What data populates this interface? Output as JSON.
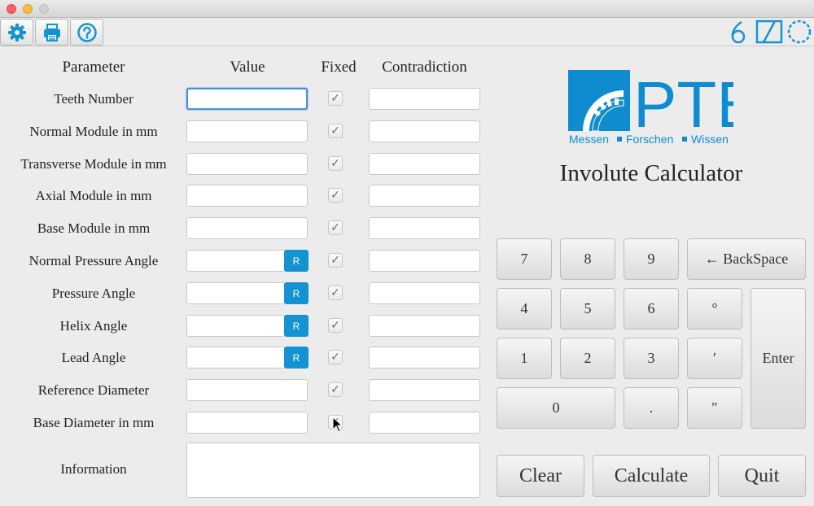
{
  "window": {
    "title": ""
  },
  "toolbar": {
    "buttons": [
      {
        "icon": "gear-icon"
      },
      {
        "icon": "printer-icon"
      },
      {
        "icon": "help-icon"
      }
    ],
    "right_icons": [
      "involute-profile-icon",
      "lead-line-icon",
      "gear-outline-icon"
    ],
    "accent_color": "#1493d3"
  },
  "table": {
    "headers": {
      "parameter": "Parameter",
      "value": "Value",
      "fixed": "Fixed",
      "contradiction": "Contradiction"
    },
    "rows": [
      {
        "label": "Teeth Number",
        "value": "",
        "has_r": false,
        "fixed": true
      },
      {
        "label": "Normal Module in mm",
        "value": "",
        "has_r": false,
        "fixed": true
      },
      {
        "label": "Transverse Module in mm",
        "value": "",
        "has_r": false,
        "fixed": true
      },
      {
        "label": "Axial Module in mm",
        "value": "",
        "has_r": false,
        "fixed": true
      },
      {
        "label": "Base Module in mm",
        "value": "",
        "has_r": false,
        "fixed": true
      },
      {
        "label": "Normal Pressure Angle",
        "value": "",
        "has_r": true,
        "fixed": true
      },
      {
        "label": "Pressure Angle",
        "value": "",
        "has_r": true,
        "fixed": true
      },
      {
        "label": "Helix Angle",
        "value": "",
        "has_r": true,
        "fixed": true
      },
      {
        "label": "Lead Angle",
        "value": "",
        "has_r": true,
        "fixed": true
      },
      {
        "label": "Reference Diameter",
        "value": "",
        "has_r": false,
        "fixed": true
      },
      {
        "label": "Base Diameter in mm",
        "value": "",
        "has_r": false,
        "fixed": true
      }
    ],
    "r_label": "R",
    "check_mark": "✓"
  },
  "information": {
    "label": "Information",
    "value": ""
  },
  "logo": {
    "text": "PTB",
    "tagline_1": "Messen",
    "tagline_2": "Forschen",
    "tagline_3": "Wissen",
    "color": "#0f8ccf"
  },
  "app_title": "Involute Calculator",
  "keypad": {
    "k7": "7",
    "k8": "8",
    "k9": "9",
    "backspace": "← BackSpace",
    "k4": "4",
    "k5": "5",
    "k6": "6",
    "degree": "°",
    "k1": "1",
    "k2": "2",
    "k3": "3",
    "minute": "′",
    "k0": "0",
    "dot": ".",
    "second": "″",
    "enter": "Enter"
  },
  "actions": {
    "clear": "Clear",
    "calculate": "Calculate",
    "quit": "Quit"
  }
}
